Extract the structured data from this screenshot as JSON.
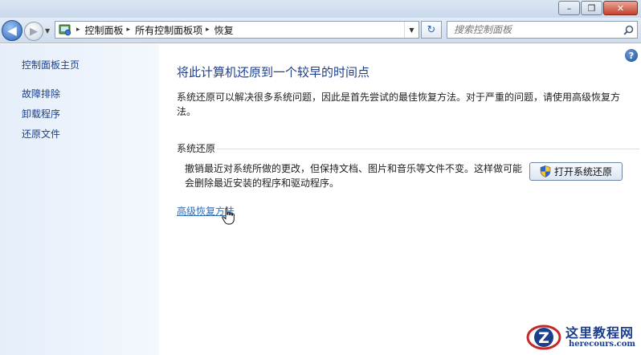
{
  "window": {
    "minimize_label": "–",
    "maximize_label": "❐",
    "close_label": "✕"
  },
  "navbar": {
    "back_glyph": "◀",
    "forward_glyph": "▶",
    "recent_glyph": "▼",
    "breadcrumb": [
      "控制面板",
      "所有控制面板项",
      "恢复"
    ],
    "breadcrumb_sep": "▸",
    "address_dropdown_glyph": "▼",
    "refresh_glyph": "↻",
    "search_placeholder": "搜索控制面板"
  },
  "sidebar": {
    "home_link": "控制面板主页",
    "links": [
      "故障排除",
      "卸载程序",
      "还原文件"
    ]
  },
  "main": {
    "help_glyph": "?",
    "title": "将此计算机还原到一个较早的时间点",
    "description": "系统还原可以解决很多系统问题，因此是首先尝试的最佳恢复方法。对于严重的问题，请使用高级恢复方法。",
    "system_restore": {
      "group_label": "系统还原",
      "description": "撤销最近对系统所做的更改，但保持文档、图片和音乐等文件不变。这样做可能会删除最近安装的程序和驱动程序。",
      "button_label": "打开系统还原"
    },
    "advanced_link": "高级恢复方法"
  },
  "watermark": {
    "logo_letter": "Z",
    "title": "这里教程网",
    "domain": "herecours.com"
  },
  "icons": {
    "control_panel": "control-panel-icon",
    "search": "search-icon",
    "shield": "uac-shield-icon",
    "cursor": "hand-cursor-icon"
  },
  "colors": {
    "link": "#1c3f87",
    "title": "#1e3e8c",
    "advanced_link": "#2f6eb5",
    "sidebar_bg": "#e5eefa",
    "close_button": "#c6412c"
  }
}
